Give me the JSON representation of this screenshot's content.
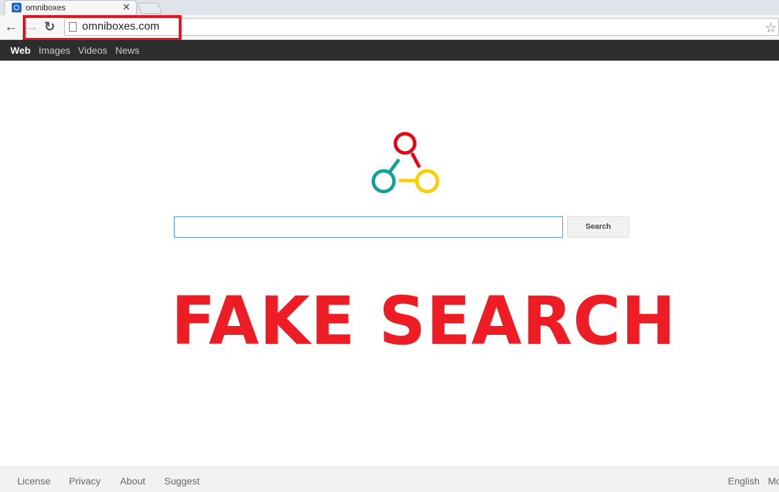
{
  "browser": {
    "tab_title": "omniboxes",
    "url": "omniboxes.com"
  },
  "topnav": [
    "Web",
    "Images",
    "Videos",
    "News"
  ],
  "search": {
    "value": "",
    "button": "Search"
  },
  "logo": {
    "colors": [
      "#e30613",
      "#0fa397",
      "#ffcc00"
    ]
  },
  "banner": {
    "text": "FAKE SEARCH",
    "color": "#ee1c25"
  },
  "footer": {
    "links": [
      "License",
      "Privacy",
      "About",
      "Suggest"
    ],
    "right": [
      "English",
      "Mo"
    ]
  }
}
